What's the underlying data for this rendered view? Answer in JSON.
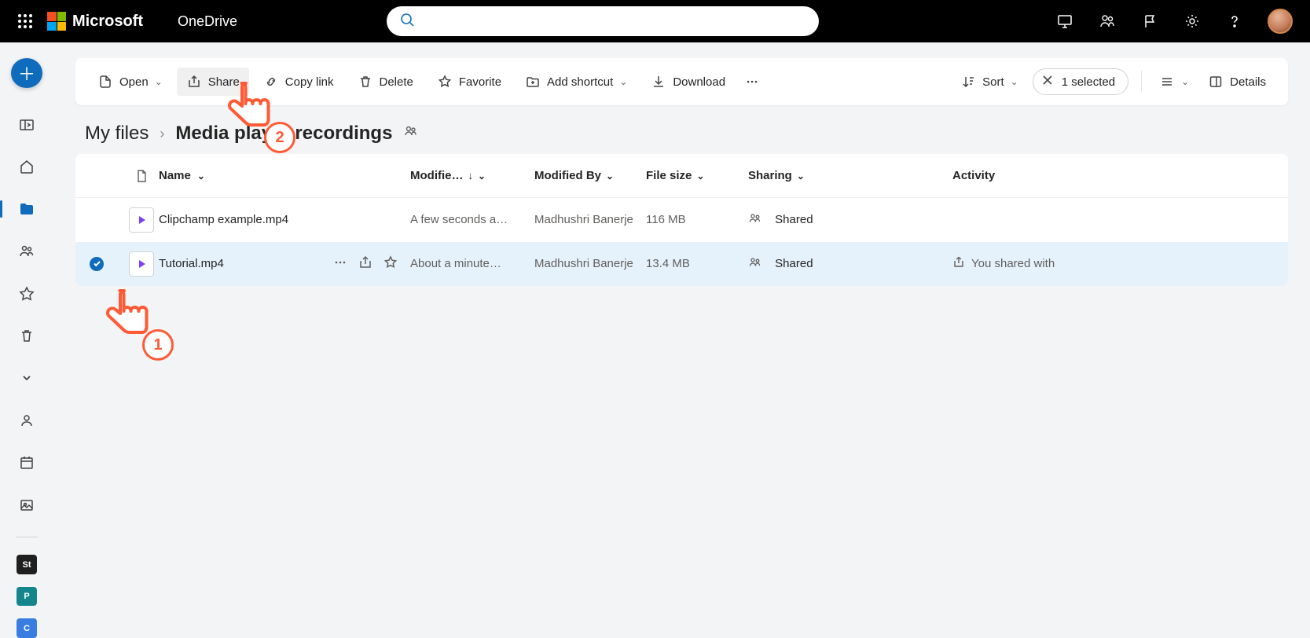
{
  "header": {
    "brand": "Microsoft",
    "app": "OneDrive"
  },
  "commands": {
    "open": "Open",
    "share": "Share",
    "copylink": "Copy link",
    "delete": "Delete",
    "favorite": "Favorite",
    "addshortcut": "Add shortcut",
    "download": "Download",
    "sort": "Sort",
    "selected": "1 selected",
    "details": "Details"
  },
  "breadcrumb": {
    "root": "My files",
    "current": "Media player recordings"
  },
  "columns": {
    "name": "Name",
    "modified": "Modifie…",
    "modifiedby": "Modified By",
    "filesize": "File size",
    "sharing": "Sharing",
    "activity": "Activity"
  },
  "rows": [
    {
      "name": "Clipchamp example.mp4",
      "modified": "A few seconds a…",
      "modifiedby": "Madhushri Banerje",
      "size": "116 MB",
      "sharing": "Shared",
      "activity": "",
      "selected": false
    },
    {
      "name": "Tutorial.mp4",
      "modified": "About a minute…",
      "modifiedby": "Madhushri Banerje",
      "size": "13.4 MB",
      "sharing": "Shared",
      "activity": "You shared with",
      "selected": true
    }
  ],
  "annotations": {
    "step1": "1",
    "step2": "2"
  }
}
